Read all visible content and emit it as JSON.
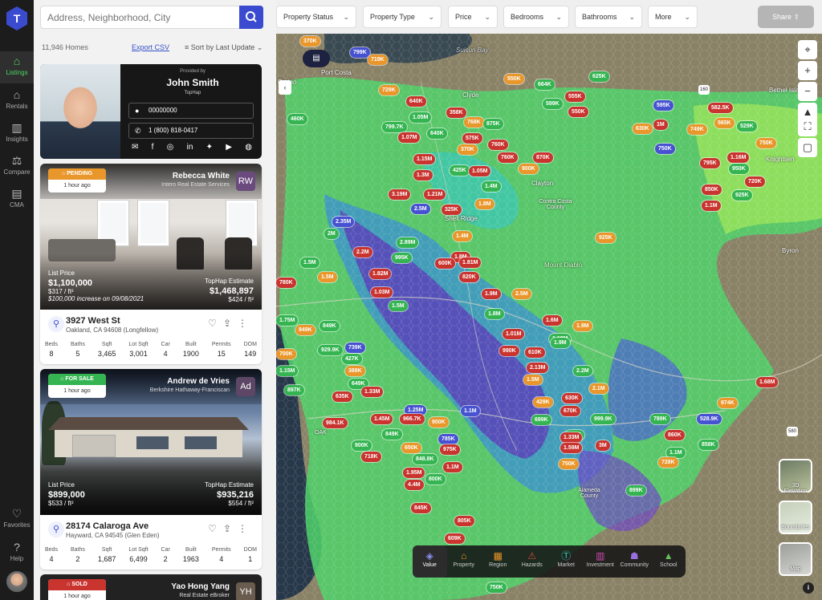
{
  "nav": {
    "items": [
      {
        "label": "Listings",
        "icon": "home-icon",
        "active": true
      },
      {
        "label": "Rentals",
        "icon": "rentals-icon",
        "active": false
      },
      {
        "label": "Insights",
        "icon": "bar-chart-icon",
        "active": false
      },
      {
        "label": "Compare",
        "icon": "scale-icon",
        "active": false
      },
      {
        "label": "CMA",
        "icon": "document-chart-icon",
        "active": false
      }
    ],
    "favorites": "Favorites",
    "help": "Help"
  },
  "search": {
    "placeholder": "Address, Neighborhood, City"
  },
  "results": {
    "count": "11,946 Homes",
    "export": "Export CSV",
    "sort": "Sort by Last Update"
  },
  "agent": {
    "provided_by": "Provided by",
    "name": "John Smith",
    "company": "TopHap",
    "id": "00000000",
    "phone": "1 (800) 818-0417"
  },
  "listings": [
    {
      "status": "PENDING",
      "status_color": "#e9962a",
      "time": "1 hour ago",
      "agent": "Rebecca White",
      "agent_company": "Intero Real Estate Services",
      "initials": "RW",
      "price_label": "List Price",
      "price": "$1,100,000",
      "price_sqft": "$317 / ft²",
      "note": "$100,000 increase on 09/08/2021",
      "est_label": "TopHap Estimate",
      "est": "$1,468,897",
      "est_sqft": "$424 / ft²",
      "street": "3927 West St",
      "city": "Oakland, CA 94608 (Longfellow)",
      "facts": [
        {
          "k": "Beds",
          "v": "8"
        },
        {
          "k": "Baths",
          "v": "5"
        },
        {
          "k": "Sqft",
          "v": "3,465"
        },
        {
          "k": "Lot Sqft",
          "v": "3,001"
        },
        {
          "k": "Car",
          "v": "4"
        },
        {
          "k": "Built",
          "v": "1900"
        },
        {
          "k": "Permits",
          "v": "15"
        },
        {
          "k": "DOM",
          "v": "149"
        }
      ]
    },
    {
      "status": "FOR SALE",
      "status_color": "#35b552",
      "time": "1 hour ago",
      "agent": "Andrew de Vries",
      "agent_company": "Berkshire Hathaway-Franciscan",
      "initials": "Ad",
      "price_label": "List Price",
      "price": "$899,000",
      "price_sqft": "$533 / ft²",
      "est_label": "TopHap Estimate",
      "est": "$935,216",
      "est_sqft": "$554 / ft²",
      "street": "28174 Calaroga Ave",
      "city": "Hayward, CA 94545 (Glen Eden)",
      "facts": [
        {
          "k": "Beds",
          "v": "4"
        },
        {
          "k": "Baths",
          "v": "2"
        },
        {
          "k": "Sqft",
          "v": "1,687"
        },
        {
          "k": "Lot Sqft",
          "v": "6,499"
        },
        {
          "k": "Car",
          "v": "2"
        },
        {
          "k": "Built",
          "v": "1963"
        },
        {
          "k": "Permits",
          "v": "4"
        },
        {
          "k": "DOM",
          "v": "1"
        }
      ]
    },
    {
      "status": "SOLD",
      "status_color": "#c9342f",
      "time": "1 hour ago",
      "agent": "Yao Hong Yang",
      "agent_company": "Real Estate eBroker",
      "initials": "YH"
    }
  ],
  "filters": [
    "Property Status",
    "Property Type",
    "Price",
    "Bedrooms",
    "Bathrooms",
    "More"
  ],
  "share": "Share",
  "map": {
    "places": [
      "Port Costa",
      "Rodeo",
      "Clyde",
      "Suisun Bay",
      "Clayton",
      "Contra Costa County",
      "Shell Ridge",
      "Mount Diablo",
      "Knightsen",
      "Byron",
      "Bethel Island",
      "Alameda County",
      "OAK"
    ],
    "road_shields": [
      "160",
      "580"
    ],
    "pins": [
      {
        "t": "370K",
        "c": "orange"
      },
      {
        "t": "799K",
        "c": "blue"
      },
      {
        "t": "719K",
        "c": "orange"
      },
      {
        "t": "550K",
        "c": "orange"
      },
      {
        "t": "625K",
        "c": "green"
      },
      {
        "t": "664K",
        "c": "green"
      },
      {
        "t": "729K",
        "c": "orange"
      },
      {
        "t": "640K",
        "c": "red"
      },
      {
        "t": "555K",
        "c": "red"
      },
      {
        "t": "599K",
        "c": "green"
      },
      {
        "t": "550K",
        "c": "red"
      },
      {
        "t": "595K",
        "c": "blue"
      },
      {
        "t": "582.5K",
        "c": "red"
      },
      {
        "t": "565K",
        "c": "orange"
      },
      {
        "t": "1.05M",
        "c": "green"
      },
      {
        "t": "358K",
        "c": "red"
      },
      {
        "t": "768K",
        "c": "orange"
      },
      {
        "t": "875K",
        "c": "green"
      },
      {
        "t": "630K",
        "c": "orange"
      },
      {
        "t": "1M",
        "c": "red"
      },
      {
        "t": "749K",
        "c": "orange"
      },
      {
        "t": "529K",
        "c": "green"
      },
      {
        "t": "460K",
        "c": "green"
      },
      {
        "t": "799.7K",
        "c": "green"
      },
      {
        "t": "640K",
        "c": "green"
      },
      {
        "t": "1.07M",
        "c": "red"
      },
      {
        "t": "575K",
        "c": "red"
      },
      {
        "t": "760K",
        "c": "red"
      },
      {
        "t": "750K",
        "c": "orange"
      },
      {
        "t": "370K",
        "c": "orange"
      },
      {
        "t": "750K",
        "c": "blue"
      },
      {
        "t": "760K",
        "c": "red"
      },
      {
        "t": "870K",
        "c": "red"
      },
      {
        "t": "1.15M",
        "c": "red"
      },
      {
        "t": "425K",
        "c": "green"
      },
      {
        "t": "1.05M",
        "c": "red"
      },
      {
        "t": "900K",
        "c": "orange"
      },
      {
        "t": "795K",
        "c": "red"
      },
      {
        "t": "1.16M",
        "c": "red"
      },
      {
        "t": "950K",
        "c": "green"
      },
      {
        "t": "1.3M",
        "c": "red"
      },
      {
        "t": "1.4M",
        "c": "green"
      },
      {
        "t": "720K",
        "c": "red"
      },
      {
        "t": "3.19M",
        "c": "red"
      },
      {
        "t": "1.21M",
        "c": "red"
      },
      {
        "t": "850K",
        "c": "red"
      },
      {
        "t": "925K",
        "c": "green"
      },
      {
        "t": "1.8M",
        "c": "orange"
      },
      {
        "t": "2.5M",
        "c": "blue"
      },
      {
        "t": "325K",
        "c": "red"
      },
      {
        "t": "1.1M",
        "c": "red"
      },
      {
        "t": "2.35M",
        "c": "blue"
      },
      {
        "t": "2M",
        "c": "green"
      },
      {
        "t": "1.4M",
        "c": "orange"
      },
      {
        "t": "925K",
        "c": "orange"
      },
      {
        "t": "2.89M",
        "c": "green"
      },
      {
        "t": "2.2M",
        "c": "red"
      },
      {
        "t": "995K",
        "c": "green"
      },
      {
        "t": "1.8M",
        "c": "red"
      },
      {
        "t": "1.81M",
        "c": "red"
      },
      {
        "t": "1.5M",
        "c": "green"
      },
      {
        "t": "600K",
        "c": "red"
      },
      {
        "t": "1.5M",
        "c": "orange"
      },
      {
        "t": "1.82M",
        "c": "red"
      },
      {
        "t": "820K",
        "c": "red"
      },
      {
        "t": "780K",
        "c": "red"
      },
      {
        "t": "1.03M",
        "c": "red"
      },
      {
        "t": "1.9M",
        "c": "red"
      },
      {
        "t": "2.5M",
        "c": "orange"
      },
      {
        "t": "1.5M",
        "c": "green"
      },
      {
        "t": "1.75M",
        "c": "green"
      },
      {
        "t": "1.8M",
        "c": "green"
      },
      {
        "t": "1.6M",
        "c": "red"
      },
      {
        "t": "1.9M",
        "c": "orange"
      },
      {
        "t": "949K",
        "c": "orange"
      },
      {
        "t": "849K",
        "c": "green"
      },
      {
        "t": "1.01M",
        "c": "red"
      },
      {
        "t": "1.19M",
        "c": "green"
      },
      {
        "t": "700K",
        "c": "orange"
      },
      {
        "t": "739K",
        "c": "blue"
      },
      {
        "t": "929.9K",
        "c": "green"
      },
      {
        "t": "990K",
        "c": "red"
      },
      {
        "t": "610K",
        "c": "red"
      },
      {
        "t": "1.9M",
        "c": "green"
      },
      {
        "t": "427K",
        "c": "green"
      },
      {
        "t": "1.15M",
        "c": "green"
      },
      {
        "t": "389K",
        "c": "orange"
      },
      {
        "t": "2.13M",
        "c": "red"
      },
      {
        "t": "2.2M",
        "c": "green"
      },
      {
        "t": "1.5M",
        "c": "orange"
      },
      {
        "t": "649K",
        "c": "green"
      },
      {
        "t": "1.68M",
        "c": "red"
      },
      {
        "t": "897K",
        "c": "green"
      },
      {
        "t": "1.33M",
        "c": "red"
      },
      {
        "t": "2.1M",
        "c": "orange"
      },
      {
        "t": "635K",
        "c": "red"
      },
      {
        "t": "429K",
        "c": "orange"
      },
      {
        "t": "630K",
        "c": "red"
      },
      {
        "t": "974K",
        "c": "orange"
      },
      {
        "t": "1.25M",
        "c": "blue"
      },
      {
        "t": "670K",
        "c": "red"
      },
      {
        "t": "1.1M",
        "c": "blue"
      },
      {
        "t": "984.1K",
        "c": "red"
      },
      {
        "t": "1.45M",
        "c": "red"
      },
      {
        "t": "966.7K",
        "c": "red"
      },
      {
        "t": "900K",
        "c": "orange"
      },
      {
        "t": "699K",
        "c": "green"
      },
      {
        "t": "999.9K",
        "c": "green"
      },
      {
        "t": "789K",
        "c": "green"
      },
      {
        "t": "528.9K",
        "c": "blue"
      },
      {
        "t": "849K",
        "c": "green"
      },
      {
        "t": "1.7M",
        "c": "green"
      },
      {
        "t": "785K",
        "c": "blue"
      },
      {
        "t": "1.33M",
        "c": "red"
      },
      {
        "t": "860K",
        "c": "red"
      },
      {
        "t": "900K",
        "c": "green"
      },
      {
        "t": "650K",
        "c": "orange"
      },
      {
        "t": "975K",
        "c": "red"
      },
      {
        "t": "1.59M",
        "c": "red"
      },
      {
        "t": "3M",
        "c": "red"
      },
      {
        "t": "1.1M",
        "c": "green"
      },
      {
        "t": "858K",
        "c": "green"
      },
      {
        "t": "718K",
        "c": "red"
      },
      {
        "t": "848.8K",
        "c": "green"
      },
      {
        "t": "1.1M",
        "c": "red"
      },
      {
        "t": "1.95M",
        "c": "red"
      },
      {
        "t": "750K",
        "c": "orange"
      },
      {
        "t": "728K",
        "c": "orange"
      },
      {
        "t": "800K",
        "c": "green"
      },
      {
        "t": "4.4M",
        "c": "red"
      },
      {
        "t": "899K",
        "c": "green"
      },
      {
        "t": "845K",
        "c": "red"
      },
      {
        "t": "805K",
        "c": "red"
      },
      {
        "t": "609K",
        "c": "red"
      },
      {
        "t": "750K",
        "c": "green"
      }
    ],
    "layers": [
      "Value",
      "Property",
      "Region",
      "Hazards",
      "Market",
      "Investment",
      "Community",
      "School"
    ],
    "active_layer": "Value",
    "side_layers": [
      "3D Elevation",
      "Boundaries",
      "Map"
    ]
  }
}
